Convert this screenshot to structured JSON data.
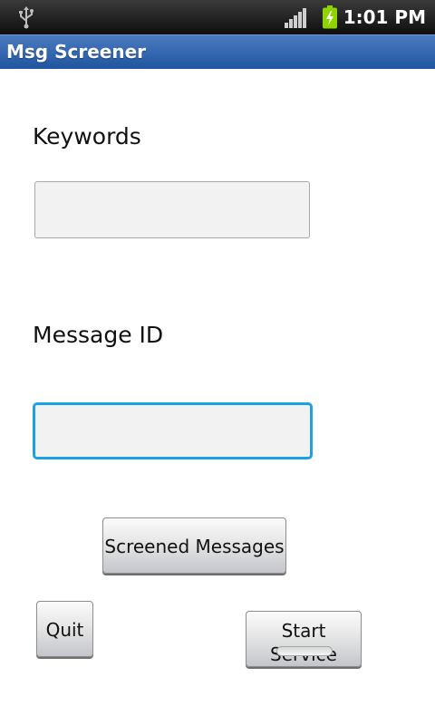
{
  "status_bar": {
    "time": "1:01 PM",
    "icons": [
      "usb-icon",
      "signal-icon",
      "battery-charging-icon"
    ]
  },
  "app": {
    "title": "Msg Screener"
  },
  "form": {
    "keywords_label": "Keywords",
    "keywords_value": "",
    "message_id_label": "Message ID",
    "message_id_value": ""
  },
  "buttons": {
    "screened_messages": "Screened Messages",
    "quit": "Quit",
    "start_service": "Start Service",
    "start_service_on": false
  },
  "colors": {
    "title_bar": "#2a5fa8",
    "focus_border": "#1aa1e6",
    "battery": "#8fd400"
  }
}
